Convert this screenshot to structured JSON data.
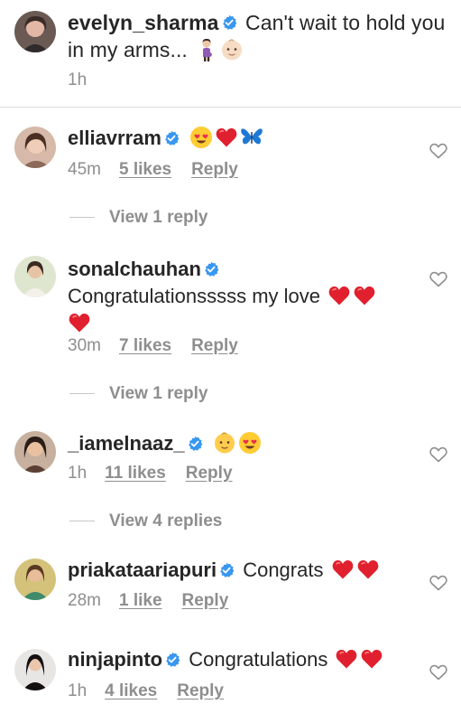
{
  "post": {
    "username": "evelyn_sharma",
    "caption": "Can't wait to hold you in my arms...",
    "time": "1h"
  },
  "comments": [
    {
      "username": "elliavrram",
      "text": "",
      "time": "45m",
      "likes": "5 likes",
      "reply": "Reply",
      "view_replies": "View 1 reply",
      "emojis": [
        "heart-eyes-emoji",
        "red-heart-emoji",
        "blue-butterfly-emoji"
      ]
    },
    {
      "username": "sonalchauhan",
      "text": "Congratulationsssss my love",
      "time": "30m",
      "likes": "7 likes",
      "reply": "Reply",
      "view_replies": "View 1 reply",
      "emojis": [
        "red-heart-emoji",
        "red-heart-emoji",
        "red-heart-emoji"
      ]
    },
    {
      "username": "_iamelnaaz_",
      "text": "",
      "time": "1h",
      "likes": "11 likes",
      "reply": "Reply",
      "view_replies": "View 4 replies",
      "emojis": [
        "baby-face-emoji",
        "heart-eyes-emoji"
      ]
    },
    {
      "username": "priakataariapuri",
      "text": "Congrats",
      "time": "28m",
      "likes": "1 like",
      "reply": "Reply",
      "emojis": [
        "red-heart-emoji",
        "red-heart-emoji"
      ]
    },
    {
      "username": "ninjapinto",
      "text": "Congratulations",
      "time": "1h",
      "likes": "4 likes",
      "reply": "Reply",
      "emojis": [
        "red-heart-emoji",
        "red-heart-emoji"
      ]
    }
  ],
  "colors": {
    "text": "#262626",
    "secondary": "#8e8e8e",
    "verified": "#3897f0",
    "heart": "#ed4956"
  }
}
